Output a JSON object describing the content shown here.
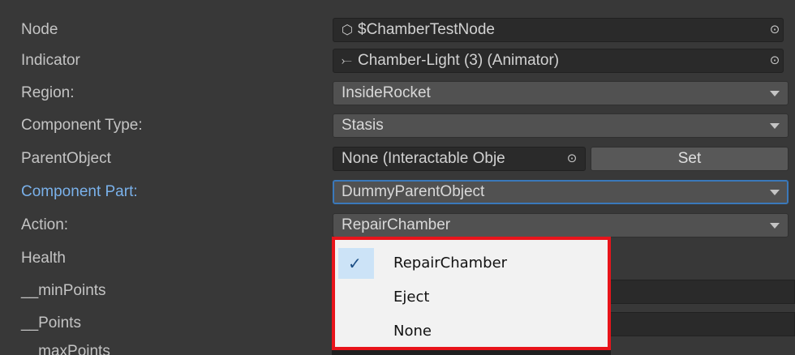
{
  "rows": {
    "node": {
      "label": "Node",
      "value": "$ChamberTestNode",
      "icon": "cube-icon"
    },
    "indicator": {
      "label": "Indicator",
      "value": "Chamber-Light (3) (Animator)",
      "icon": "animator-icon"
    },
    "region": {
      "label": "Region:",
      "value": "InsideRocket"
    },
    "component_type": {
      "label": "Component Type:",
      "value": "Stasis"
    },
    "parent_object": {
      "label": "ParentObject",
      "value": "None (Interactable Obje",
      "button": "Set"
    },
    "component_part": {
      "label": "Component Part:",
      "value": "DummyParentObject"
    },
    "action": {
      "label": "Action:",
      "value": "RepairChamber"
    },
    "health": {
      "label": "Health"
    },
    "min_points": {
      "label": "__minPoints"
    },
    "points": {
      "label": "__Points"
    },
    "max_points": {
      "label": "__maxPoints"
    }
  },
  "popup": {
    "items": [
      {
        "label": "RepairChamber",
        "checked": true
      },
      {
        "label": "Eject",
        "checked": false
      },
      {
        "label": "None",
        "checked": false
      }
    ],
    "check_glyph": "✓"
  },
  "glyphs": {
    "cube": "⬡",
    "animator": "⤚",
    "picker": "⊙"
  },
  "colors": {
    "background": "#383838",
    "label_highlight": "#7ab1ea",
    "popup_border": "#e8141b",
    "popup_bg": "#f2f2f2",
    "selection_bg": "#cce3f7"
  }
}
